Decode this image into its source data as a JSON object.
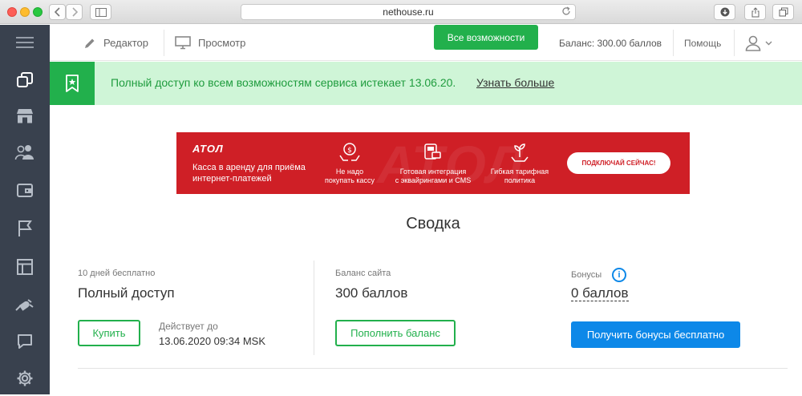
{
  "browser": {
    "url": "nethouse.ru"
  },
  "toolbar": {
    "editor_label": "Редактор",
    "preview_label": "Просмотр",
    "all_features_label": "Все возможности",
    "balance_label": "Баланс: 300.00 баллов",
    "help_label": "Помощь"
  },
  "notice": {
    "text": "Полный доступ ко всем возможностям сервиса истекает 13.06.20.",
    "link": "Узнать больше"
  },
  "ad": {
    "logo": "АТОЛ",
    "tagline_line1": "Касса в аренду для приёма",
    "tagline_line2": "интернет-платежей",
    "features": [
      {
        "line1": "Не надо",
        "line2": "покупать кассу"
      },
      {
        "line1": "Готовая интеграция",
        "line2": "с эквайрингами и CMS"
      },
      {
        "line1": "Гибкая тарифная",
        "line2": "политика"
      }
    ],
    "button_label": "ПОДКЛЮЧАЙ СЕЙЧАС!"
  },
  "summary": {
    "title": "Сводка",
    "plan": {
      "label": "10 дней бесплатно",
      "value": "Полный доступ",
      "button": "Купить",
      "valid_label": "Действует до",
      "valid_value": "13.06.2020 09:34 MSK"
    },
    "balance": {
      "label": "Баланс сайта",
      "value": "300 баллов",
      "button": "Пополнить баланс"
    },
    "bonuses": {
      "label": "Бонусы",
      "info_glyph": "i",
      "value": "0 баллов",
      "button": "Получить бонусы бесплатно"
    }
  },
  "colors": {
    "green": "#22b04c",
    "sidebar": "#39414e",
    "blue": "#0d88e8",
    "ad_red": "#cf1f26"
  }
}
